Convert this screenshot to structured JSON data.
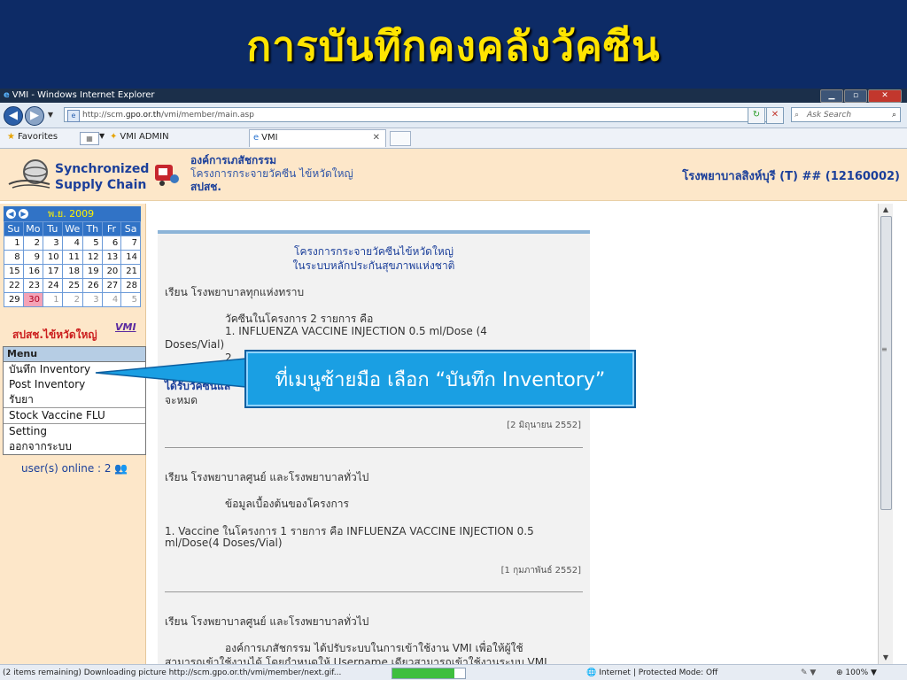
{
  "slide": {
    "title": "การบันทึกคงคลังวัคซีน"
  },
  "browser": {
    "window_title": "VMI - Windows Internet Explorer",
    "window_buttons": [
      "▁",
      "▫",
      "✕"
    ],
    "url_prefix": "http://scm.",
    "url_domain": "gpo.or.th",
    "url_path": "/vmi/member/main.asp",
    "search_placeholder": "Ask Search",
    "favorites_label": "Favorites",
    "tab_vmiadmin": "VMI ADMIN",
    "tab_vmi": "VMI",
    "status_message": "(2 items remaining) Downloading picture http://scm.gpo.or.th/vmi/member/next.gif...",
    "progress": 0.85,
    "zone": "Internet | Protected Mode: Off",
    "zoom": "100%"
  },
  "header": {
    "logo_line1": "Synchronized",
    "logo_line2": "Supply Chain",
    "org_name": "องค์การเภสัชกรรม",
    "project_name": "โครงการกระจายวัคซีน ไข้หวัดใหญ่",
    "unit_name": "สปสช.",
    "hospital": "โรงพยาบาลสิงห์บุรี (T) ## (12160002)"
  },
  "calendar": {
    "month_label": "พ.ย. 2009",
    "weekdays": [
      "Su",
      "Mo",
      "Tu",
      "We",
      "Th",
      "Fr",
      "Sa"
    ],
    "weeks": [
      [
        "1",
        "2",
        "3",
        "4",
        "5",
        "6",
        "7"
      ],
      [
        "8",
        "9",
        "10",
        "11",
        "12",
        "13",
        "14"
      ],
      [
        "15",
        "16",
        "17",
        "18",
        "19",
        "20",
        "21"
      ],
      [
        "22",
        "23",
        "24",
        "25",
        "26",
        "27",
        "28"
      ],
      [
        "29",
        "30",
        "1",
        "2",
        "3",
        "4",
        "5"
      ]
    ],
    "today": "30"
  },
  "sidebar": {
    "dept_label": "สปสช.ไข้หวัดใหญ่",
    "vmi_mark": "VMI",
    "menu_title": "Menu",
    "menu_items": [
      "บันทึก Inventory",
      "Post Inventory",
      "รับยา",
      "Stock Vaccine FLU",
      "Setting",
      "ออกจากระบบ"
    ],
    "online": "user(s) online : 2"
  },
  "notices": {
    "n1_title1": "โครงการกระจายวัคซีนไข้หวัดใหญ่",
    "n1_title2": "ในระบบหลักประกันสุขภาพแห่งชาติ",
    "n1_greeting": "เรียน โรงพยาบาลทุกแห่งทราบ",
    "n1_p1": "วัคซีนในโครงการ 2 รายการ คือ",
    "n1_p2": "1. INFLUENZA VACCINE INJECTION 0.5 ml/Dose (4",
    "n1_p3": "Doses/Vial)",
    "n1_p4": "2.",
    "n1_p5": "ได้รับวัคซีนแล",
    "n1_p6": "จะหมด",
    "n1_date": "[2 มิถุนายน 2552]",
    "n2_greeting": "เรียน โรงพยาบาลศูนย์ และโรงพยาบาลทั่วไป",
    "n2_p1": "ข้อมูลเบื้องต้นของโครงการ",
    "n2_p2": "1. Vaccine ในโครงการ 1 รายการ คือ INFLUENZA VACCINE INJECTION 0.5",
    "n2_p3": "ml/Dose(4 Doses/Vial)",
    "n2_date": "[1 กุมภาพันธ์ 2552]",
    "n3_greeting": "เรียน โรงพยาบาลศูนย์ และโรงพยาบาลทั่วไป",
    "n3_p1": "องค์การเภสัชกรรม ได้ปรับระบบในการเข้าใช้งาน VMI เพื่อให้ผู้ใช้",
    "n3_p2": "สามารถเข้าใช้งานได้ โดยกำหนดให้ Username เดียวสามารถเข้าใช้งานระบบ VMI"
  },
  "callout": {
    "text": "ที่เมนูซ้ายมือ เลือก “บันทึก Inventory”"
  }
}
